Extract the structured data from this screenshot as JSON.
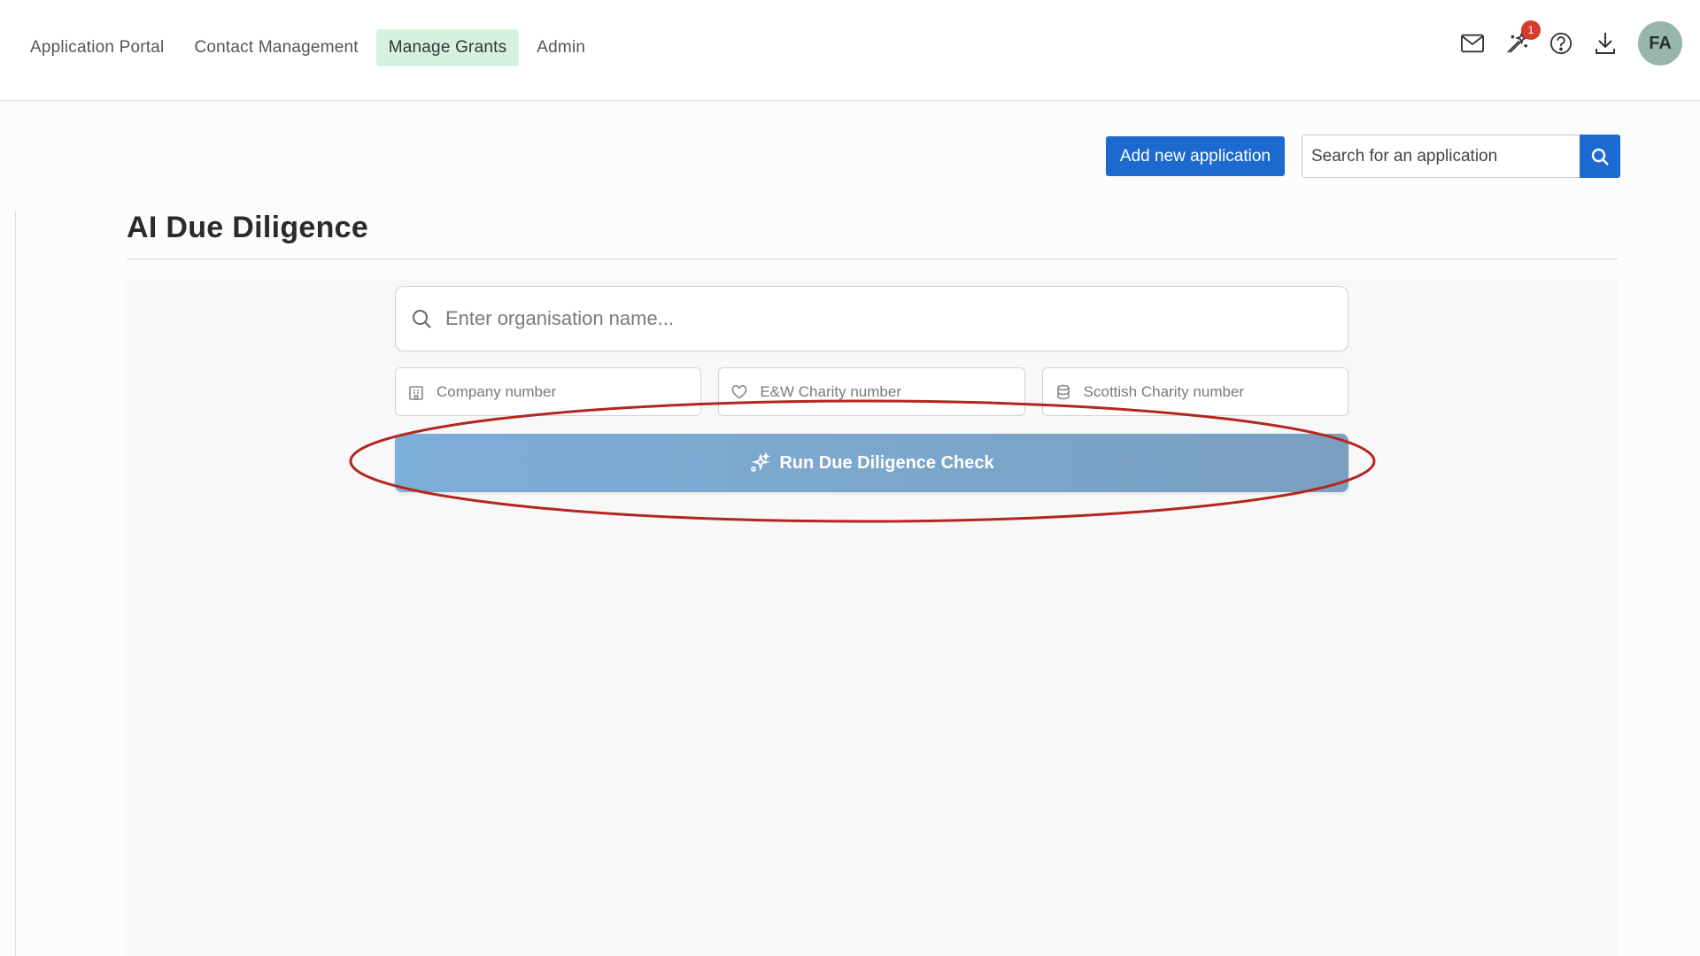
{
  "nav": {
    "items": [
      {
        "label": "Application Portal",
        "active": false
      },
      {
        "label": "Contact Management",
        "active": false
      },
      {
        "label": "Manage Grants",
        "active": true
      },
      {
        "label": "Admin",
        "active": false
      }
    ]
  },
  "topbar": {
    "notification_count": "1",
    "avatar_initials": "FA",
    "icons": [
      "mail-icon",
      "magic-wand-icon",
      "help-icon",
      "download-icon"
    ]
  },
  "actions": {
    "add_label": "Add new application",
    "search_placeholder": "Search for an application"
  },
  "page": {
    "title": "AI Due Diligence"
  },
  "form": {
    "org_placeholder": "Enter organisation name...",
    "company_placeholder": "Company number",
    "ew_charity_placeholder": "E&W Charity number",
    "scottish_charity_placeholder": "Scottish Charity number",
    "run_label": "Run Due Diligence Check"
  },
  "colors": {
    "primary": "#1c6ad0",
    "active_nav_bg": "#d7f1e0",
    "run_button": "#7daed8",
    "annotation": "#b3261e",
    "badge": "#d93a2b",
    "avatar": "#98b5aa"
  }
}
